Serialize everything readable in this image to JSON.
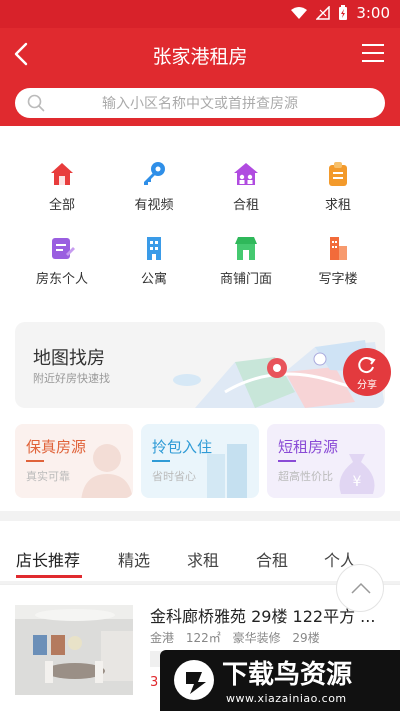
{
  "status": {
    "time": "3:00"
  },
  "header": {
    "title": "张家港租房",
    "search_placeholder": "输入小区名称中文或首拼查房源"
  },
  "categories": [
    {
      "label": "全部",
      "icon": "house-icon",
      "color": "#e83c3c"
    },
    {
      "label": "有视频",
      "icon": "key-icon",
      "color": "#2f8fe8"
    },
    {
      "label": "合租",
      "icon": "shared-house-icon",
      "color": "#b04be0"
    },
    {
      "label": "求租",
      "icon": "clipboard-icon",
      "color": "#f39a2b"
    },
    {
      "label": "房东个人",
      "icon": "note-icon",
      "color": "#9a5ee0"
    },
    {
      "label": "公寓",
      "icon": "apartment-icon",
      "color": "#3a9be8"
    },
    {
      "label": "商铺门面",
      "icon": "shop-icon",
      "color": "#2fb85a"
    },
    {
      "label": "写字楼",
      "icon": "office-icon",
      "color": "#f26b3a"
    }
  ],
  "map_card": {
    "title": "地图找房",
    "subtitle": "附近好房快速找",
    "share_label": "分享"
  },
  "features": [
    {
      "title": "保真房源",
      "subtitle": "真实可靠",
      "color": "#e0633a",
      "bg": "#fbf1ee"
    },
    {
      "title": "拎包入住",
      "subtitle": "省时省心",
      "color": "#2f9bd6",
      "bg": "#eaf5fb"
    },
    {
      "title": "短租房源",
      "subtitle": "超高性价比",
      "color": "#8a4bd6",
      "bg": "#f3effb"
    }
  ],
  "tabs": [
    "店长推荐",
    "精选",
    "求租",
    "合租",
    "个人"
  ],
  "listing": {
    "title": "金科廊桥雅苑 29楼 122平方 ...",
    "area": "金港",
    "size": "122㎡",
    "decor": "豪华装修",
    "floor": "29楼",
    "price": "3"
  },
  "watermark": {
    "text": "下载鸟资源",
    "url": "www.xiazainiao.com"
  },
  "colors": {
    "brand_red": "#e02a2f"
  }
}
